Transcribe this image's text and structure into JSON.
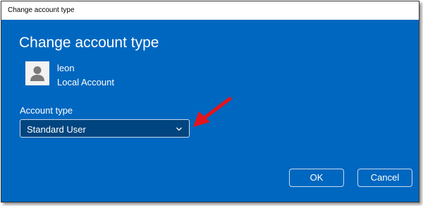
{
  "window": {
    "title": "Change account type"
  },
  "dialog": {
    "heading": "Change account type",
    "user": {
      "name": "leon",
      "type": "Local Account",
      "avatar_icon": "user-avatar-icon"
    },
    "account_type": {
      "label": "Account type",
      "selected": "Standard User",
      "dropdown_icon": "chevron-down-icon"
    },
    "buttons": {
      "ok": "OK",
      "cancel": "Cancel"
    }
  },
  "annotation": {
    "arrow_color": "#e3141b"
  },
  "colors": {
    "dialog_background": "#0067c0",
    "select_background": "#00457f",
    "text": "#ffffff"
  }
}
